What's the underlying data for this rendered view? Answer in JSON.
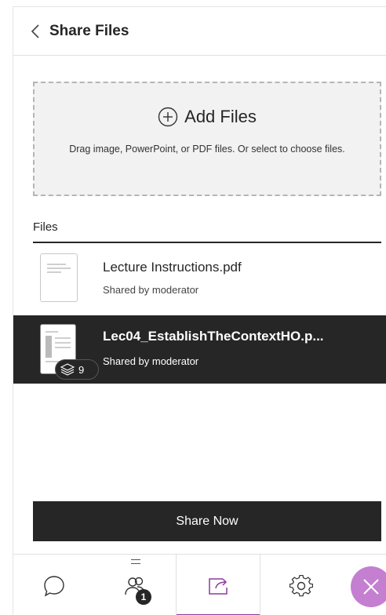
{
  "header": {
    "title": "Share Files",
    "back_icon": "chevron-left-icon"
  },
  "dropzone": {
    "add_label": "Add Files",
    "hint": "Drag image, PowerPoint, or PDF files. Or select to choose files.",
    "icon": "plus-circle-icon"
  },
  "files": {
    "heading": "Files",
    "items": [
      {
        "name": "Lecture Instructions.pdf",
        "shared_by": "Shared by moderator",
        "selected": false
      },
      {
        "name": "Lec04_EstablishTheContextHO.p...",
        "shared_by": "Shared by moderator",
        "selected": true,
        "page_count": "9"
      }
    ]
  },
  "actions": {
    "share_label": "Share Now"
  },
  "footer": {
    "tabs": [
      {
        "id": "chat",
        "icon": "chat-bubble-icon"
      },
      {
        "id": "attendees",
        "icon": "attendees-icon",
        "badge": "1"
      },
      {
        "id": "share",
        "icon": "share-content-icon",
        "active": true
      },
      {
        "id": "settings",
        "icon": "gear-icon"
      }
    ],
    "close_icon": "close-icon"
  },
  "colors": {
    "accent": "#8e3a9e",
    "close_bg": "#c47fd1",
    "dark": "#262626"
  }
}
